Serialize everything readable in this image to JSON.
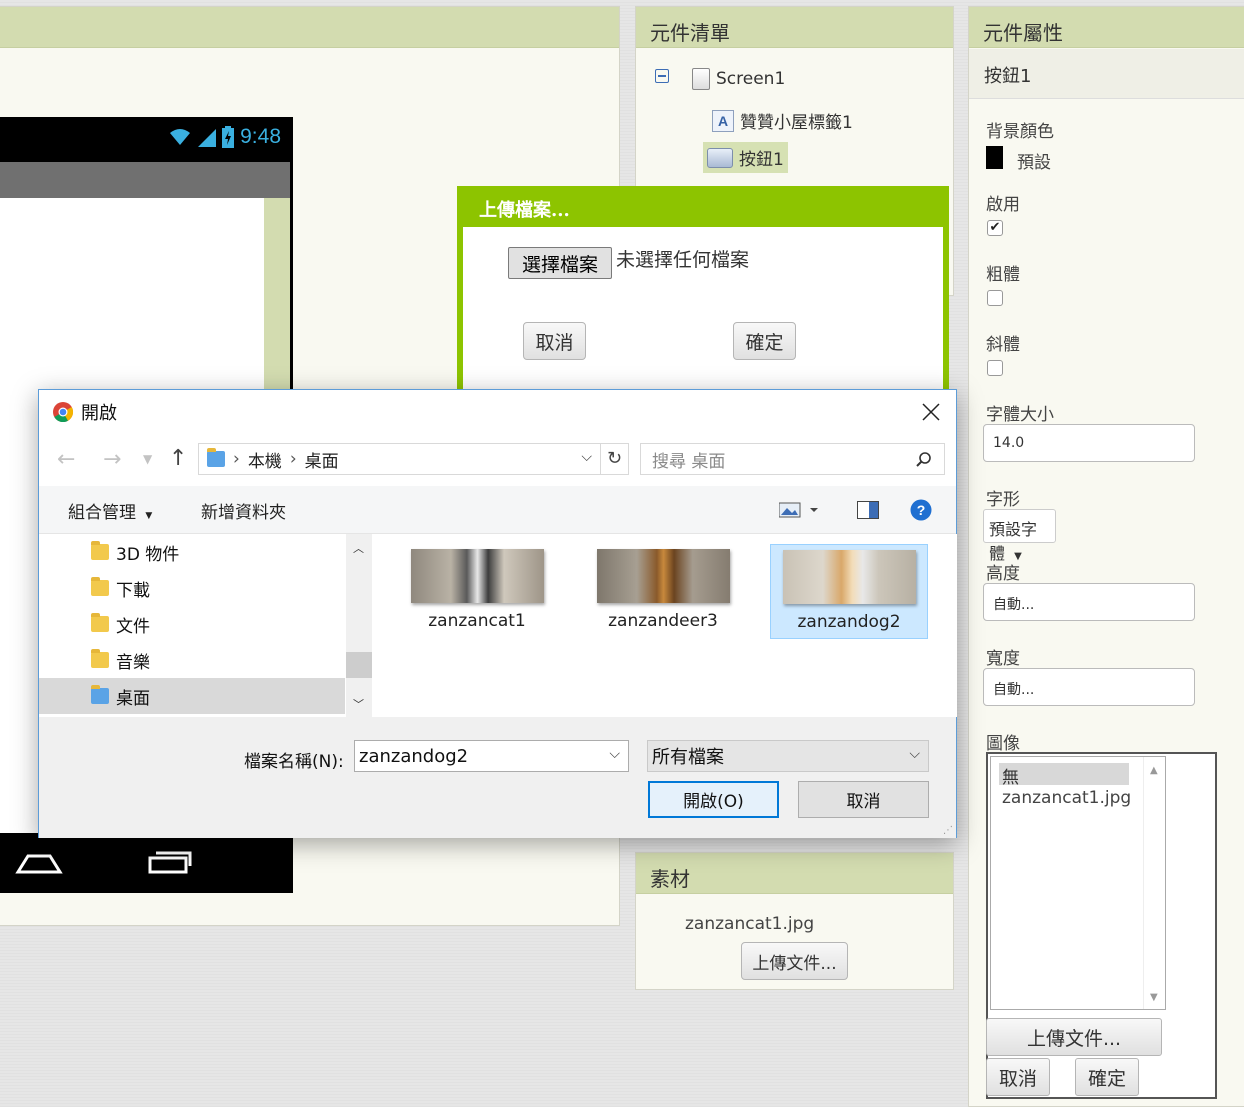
{
  "phone": {
    "time": "9:48"
  },
  "components": {
    "header": "元件清單",
    "tree": [
      {
        "label": "Screen1"
      },
      {
        "label": "贊贊小屋標籤1"
      },
      {
        "label": "按鈕1"
      }
    ]
  },
  "upload_dialog": {
    "title": "上傳檔案...",
    "choose_file_label": "選擇檔案",
    "no_file_text": "未選擇任何檔案",
    "cancel_label": "取消",
    "ok_label": "確定"
  },
  "assets": {
    "header": "素材",
    "files": [
      "zanzancat1.jpg"
    ],
    "upload_label": "上傳文件..."
  },
  "properties": {
    "header": "元件屬性",
    "component_name": "按鈕1",
    "background_color_label": "背景顏色",
    "background_color_value": "預設",
    "background_color_swatch": "#000000",
    "enabled_label": "啟用",
    "enabled_checked": true,
    "bold_label": "粗體",
    "bold_checked": false,
    "italic_label": "斜體",
    "italic_checked": false,
    "font_size_label": "字體大小",
    "font_size_value": "14.0",
    "font_typeface_label": "字形",
    "font_typeface_value": "預設字體",
    "height_label": "高度",
    "height_value": "自動...",
    "width_label": "寬度",
    "width_value": "自動...",
    "image_label": "圖像",
    "image_options": [
      "無",
      "zanzancat1.jpg"
    ],
    "image_upload_label": "上傳文件...",
    "image_cancel_label": "取消",
    "image_ok_label": "確定"
  },
  "file_dialog": {
    "title": "開啟",
    "breadcrumb": [
      "本機",
      "桌面"
    ],
    "search_placeholder": "搜尋 桌面",
    "organize_label": "組合管理",
    "new_folder_label": "新增資料夾",
    "nav_items": [
      {
        "label": "3D 物件",
        "icon": "3d-objects-icon"
      },
      {
        "label": "下載",
        "icon": "downloads-icon"
      },
      {
        "label": "文件",
        "icon": "documents-icon"
      },
      {
        "label": "音樂",
        "icon": "music-icon"
      },
      {
        "label": "桌面",
        "icon": "desktop-icon",
        "selected": true
      }
    ],
    "files": [
      {
        "name": "zanzancat1"
      },
      {
        "name": "zanzandeer3"
      },
      {
        "name": "zanzandog2",
        "selected": true
      }
    ],
    "filename_label": "檔案名稱(N):",
    "filename_value": "zanzandog2",
    "filetype_value": "所有檔案",
    "open_label": "開啟(O)",
    "cancel_label": "取消"
  },
  "colors": {
    "panel_header": "#d3dcb0",
    "upload_green": "#8dc400",
    "windows_accent": "#0078d7",
    "selection_blue": "#cce8ff"
  }
}
